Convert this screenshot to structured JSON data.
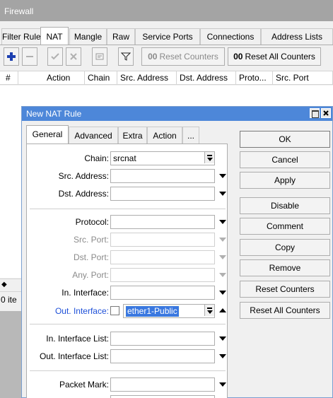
{
  "firewall": {
    "title": "Firewall",
    "tabs": [
      "Filter Rules",
      "NAT",
      "Mangle",
      "Raw",
      "Service Ports",
      "Connections",
      "Address Lists"
    ],
    "active_tab": "NAT",
    "toolbar": {
      "reset_counters": "Reset Counters",
      "reset_all_counters": "Reset All Counters",
      "counter_glyph": "00"
    },
    "columns": [
      "#",
      "Action",
      "Chain",
      "Src. Address",
      "Dst. Address",
      "Proto...",
      "Src. Port"
    ],
    "status": "0 ite"
  },
  "dialog": {
    "title": "New NAT Rule",
    "tabs": [
      "General",
      "Advanced",
      "Extra",
      "Action",
      "..."
    ],
    "active_tab": "General",
    "fields": {
      "chain": {
        "label": "Chain:",
        "value": "srcnat"
      },
      "src_address": {
        "label": "Src. Address:",
        "value": ""
      },
      "dst_address": {
        "label": "Dst. Address:",
        "value": ""
      },
      "protocol": {
        "label": "Protocol:",
        "value": ""
      },
      "src_port": {
        "label": "Src. Port:",
        "value": ""
      },
      "dst_port": {
        "label": "Dst. Port:",
        "value": ""
      },
      "any_port": {
        "label": "Any. Port:",
        "value": ""
      },
      "in_interface": {
        "label": "In. Interface:",
        "value": ""
      },
      "out_interface": {
        "label": "Out. Interface:",
        "value": "ether1-Public"
      },
      "in_interface_list": {
        "label": "In. Interface List:",
        "value": ""
      },
      "out_interface_list": {
        "label": "Out. Interface List:",
        "value": ""
      },
      "packet_mark": {
        "label": "Packet Mark:",
        "value": ""
      }
    },
    "buttons": [
      "OK",
      "Cancel",
      "Apply",
      "Disable",
      "Comment",
      "Copy",
      "Remove",
      "Reset Counters",
      "Reset All Counters"
    ]
  },
  "colors": {
    "dialog_titlebar": "#4d87d9",
    "firewall_titlebar": "#a4a4a4",
    "selection": "#3a78e0",
    "highlight_label": "#1d4fd8"
  }
}
